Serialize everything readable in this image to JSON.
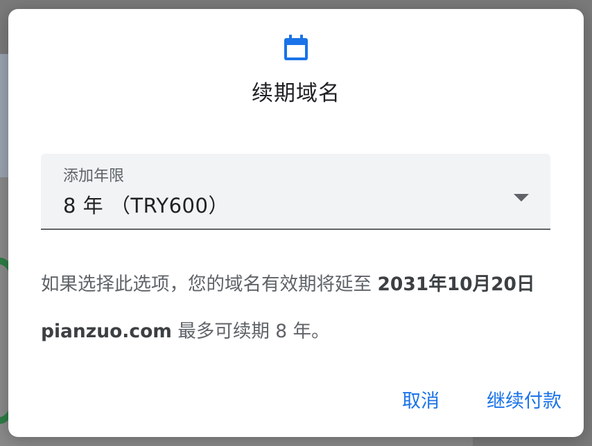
{
  "dialog": {
    "icon": "calendar-icon",
    "title": "续期域名",
    "select": {
      "label": "添加年限",
      "value": "8 年 （TRY600）"
    },
    "description": {
      "prefix": "如果选择此选项，您的域名有效期将延至 ",
      "date": "2031年10月20日",
      "domain": "pianzuo.com",
      "suffix": " 最多可续期 8 年。"
    },
    "actions": {
      "cancel": "取消",
      "continue": "继续付款"
    }
  },
  "colors": {
    "accent": "#1a73e8",
    "field_bg": "#f1f3f4",
    "text_primary": "#202124",
    "text_secondary": "#5f6368"
  }
}
